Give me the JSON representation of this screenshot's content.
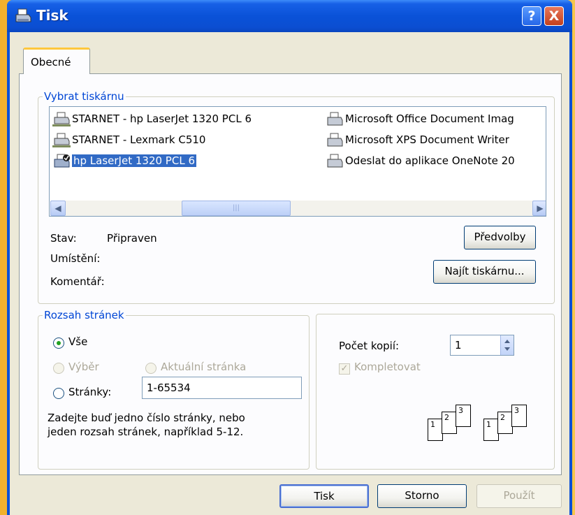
{
  "window": {
    "title": "Tisk",
    "help_label": "?",
    "close_label": "X"
  },
  "tabs": [
    {
      "label": "Obecné"
    }
  ],
  "printers": {
    "legend": "Vybrat tiskárnu",
    "items": [
      {
        "name": "STARNET - hp LaserJet 1320 PCL 6",
        "icon": "network-printer-icon"
      },
      {
        "name": "STARNET - Lexmark  C510",
        "icon": "network-printer-icon"
      },
      {
        "name": "hp LaserJet 1320 PCL 6",
        "icon": "default-printer-icon",
        "selected": true
      },
      {
        "name": "Microsoft Office Document Imag",
        "icon": "printer-icon"
      },
      {
        "name": "Microsoft XPS Document Writer",
        "icon": "printer-icon"
      },
      {
        "name": "Odeslat do aplikace OneNote 20",
        "icon": "printer-icon"
      }
    ]
  },
  "status": {
    "stav_label": "Stav:",
    "stav_value": "Připraven",
    "umisteni_label": "Umístění:",
    "komentar_label": "Komentář:",
    "preferences_button": "Předvolby",
    "find_button": "Najít tiskárnu..."
  },
  "range": {
    "legend": "Rozsah stránek",
    "all_label": "Vše",
    "selection_label": "Výběr",
    "current_label": "Aktuální stránka",
    "pages_label": "Stránky:",
    "pages_value": "1-65534",
    "hint_line1": "Zadejte buď jedno číslo stránky, nebo",
    "hint_line2": "jeden rozsah stránek, například 5-12."
  },
  "copies": {
    "label": "Počet kopií:",
    "value": "1",
    "collate_label": "Kompletovat",
    "page_numbers": [
      "1",
      "2",
      "3"
    ]
  },
  "buttons": {
    "print": "Tisk",
    "cancel": "Storno",
    "apply": "Použít"
  }
}
